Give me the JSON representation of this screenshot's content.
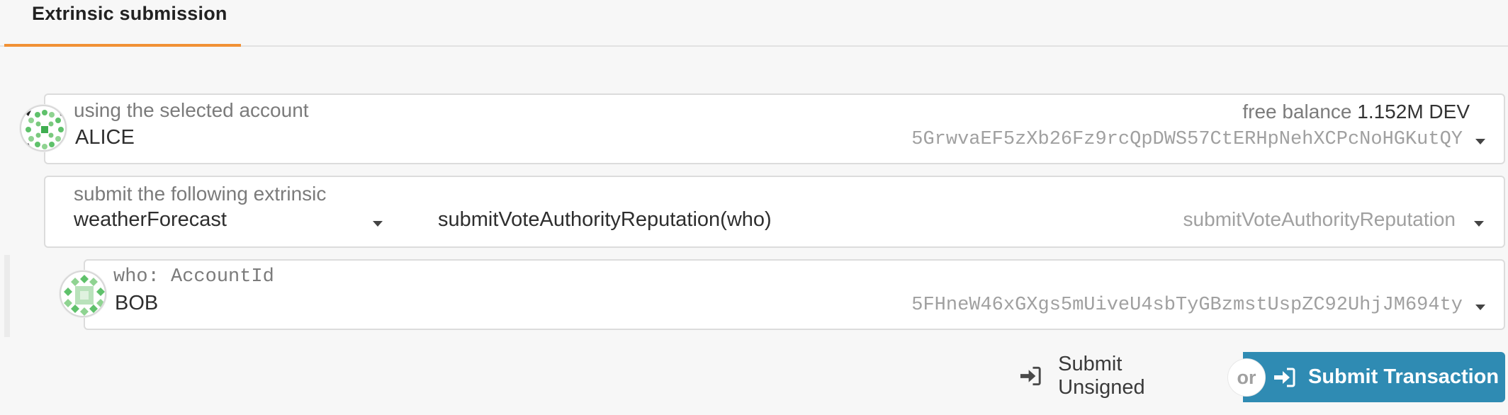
{
  "tabs": [
    {
      "label": "Extrinsic submission",
      "active": true
    }
  ],
  "account": {
    "label": "using the selected account",
    "name": "ALICE",
    "balance_label": "free balance",
    "balance_value": "1.152M DEV",
    "address": "5GrwvaEF5zXb26Fz9rcQpDWS57CtERHpNehXCPcNoHGKutQY",
    "avatar_icon": "identicon-icon"
  },
  "extrinsic": {
    "label": "submit the following extrinsic",
    "section": "weatherForecast",
    "method_signature": "submitVoteAuthorityReputation(who)",
    "method": "submitVoteAuthorityReputation"
  },
  "param": {
    "label": "who: AccountId",
    "name": "BOB",
    "address": "5FHneW46xGXgs5mUiveU4sbTyGBzmstUspZC92UhjJM694ty",
    "avatar_icon": "identicon-icon"
  },
  "actions": {
    "unsigned_label": "Submit Unsigned",
    "or_label": "or",
    "submit_label": "Submit Transaction",
    "submit_color": "#2f8bb3",
    "accent_color": "#f19135"
  }
}
